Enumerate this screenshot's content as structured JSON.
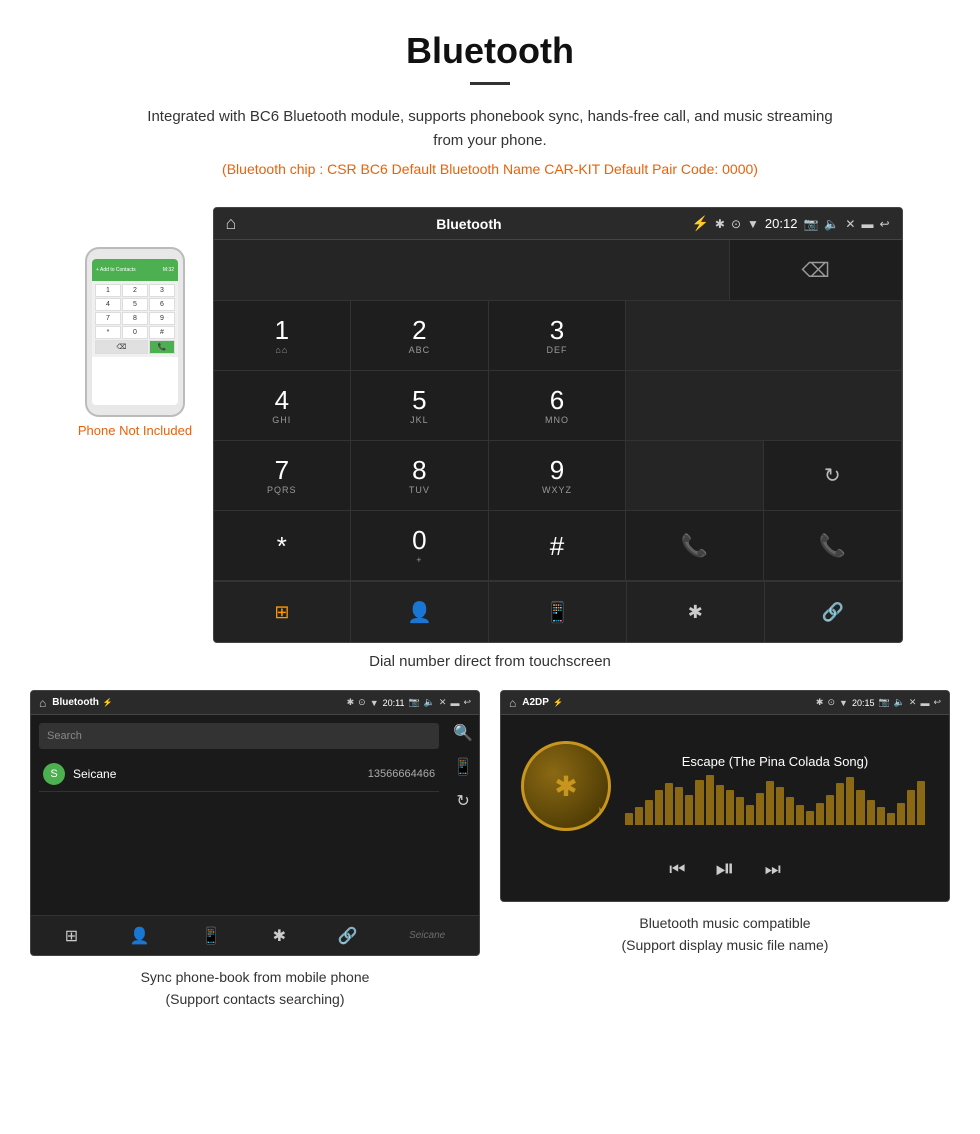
{
  "header": {
    "title": "Bluetooth",
    "description": "Integrated with BC6 Bluetooth module, supports phonebook sync, hands-free call, and music streaming from your phone.",
    "specs": "(Bluetooth chip : CSR BC6    Default Bluetooth Name CAR-KIT    Default Pair Code: 0000)"
  },
  "phone_mockup": {
    "not_included_label": "Phone Not Included",
    "screen_text": "M:32"
  },
  "dial_screen": {
    "statusbar": {
      "title": "Bluetooth",
      "time": "20:12"
    },
    "keys": [
      {
        "num": "1",
        "sub": "⌂⌂"
      },
      {
        "num": "2",
        "sub": "ABC"
      },
      {
        "num": "3",
        "sub": "DEF"
      },
      {
        "num": "*",
        "sub": ""
      },
      {
        "num": "0",
        "sub": "+"
      },
      {
        "num": "#",
        "sub": ""
      },
      {
        "num": "4",
        "sub": "GHI"
      },
      {
        "num": "5",
        "sub": "JKL"
      },
      {
        "num": "6",
        "sub": "MNO"
      },
      {
        "num": "7",
        "sub": "PQRS"
      },
      {
        "num": "8",
        "sub": "TUV"
      },
      {
        "num": "9",
        "sub": "WXYZ"
      }
    ],
    "caption": "Dial number direct from touchscreen"
  },
  "phonebook_screen": {
    "statusbar_title": "Bluetooth",
    "statusbar_time": "20:11",
    "search_placeholder": "Search",
    "contacts": [
      {
        "letter": "S",
        "name": "Seicane",
        "phone": "13566664466"
      }
    ],
    "caption_line1": "Sync phone-book from mobile phone",
    "caption_line2": "(Support contacts searching)"
  },
  "music_screen": {
    "statusbar_title": "A2DP",
    "statusbar_time": "20:15",
    "track_name": "Escape (The Pina Colada Song)",
    "caption_line1": "Bluetooth music compatible",
    "caption_line2": "(Support display music file name)"
  },
  "eq_bars": [
    12,
    18,
    25,
    35,
    42,
    38,
    30,
    45,
    50,
    40,
    35,
    28,
    20,
    32,
    44,
    38,
    28,
    20,
    14,
    22,
    30,
    42,
    48,
    35,
    25,
    18,
    12,
    22,
    35,
    44
  ]
}
